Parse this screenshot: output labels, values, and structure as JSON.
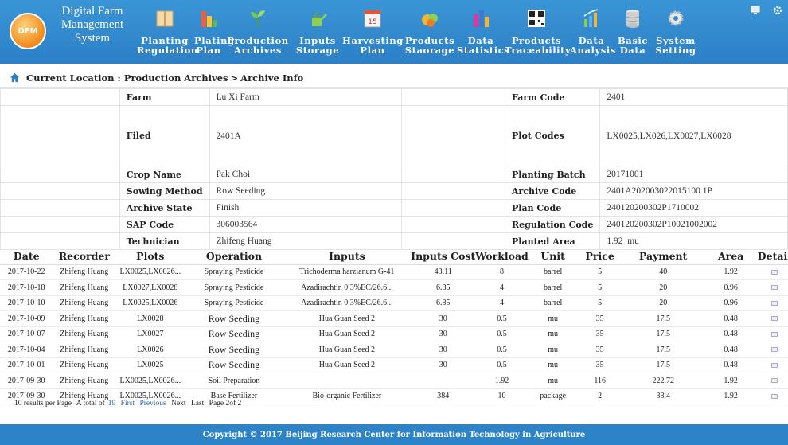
{
  "header": {
    "logo_text": "DFM",
    "system_name": [
      "Digital Farm",
      "Management",
      "System"
    ],
    "menu": [
      {
        "label": "Planting\nRegulation",
        "icon": "book-icon",
        "color": "#f6d9a6"
      },
      {
        "label": "Plating\nPlan",
        "icon": "bar-chart-icon",
        "color": "#f25d3c"
      },
      {
        "label": "Production\nArchives",
        "icon": "sprout-icon",
        "color": "#7cc84a"
      },
      {
        "label": "Inputs\nStorage",
        "icon": "watering-can-icon",
        "color": "#8fcf52"
      },
      {
        "label": "Harvesting\nPlan",
        "icon": "calendar-icon",
        "color": "#f5f5f5"
      },
      {
        "label": "Products\nStaorage",
        "icon": "produce-icon",
        "color": "#f3b535"
      },
      {
        "label": "Data\nStatistics",
        "icon": "columns-icon",
        "color": "#d93aa0"
      },
      {
        "label": "Products\nTraceability",
        "icon": "qr-code-icon",
        "color": "#222222"
      },
      {
        "label": "Data\nAnalysis",
        "icon": "analysis-icon",
        "color": "#8bd04a"
      },
      {
        "label": "Basic\nData",
        "icon": "database-icon",
        "color": "#e5e5e5"
      },
      {
        "label": "System\nSetting",
        "icon": "gear-icon",
        "color": "#e8e8e8"
      }
    ]
  },
  "breadcrumb": {
    "prefix": "Current Location :",
    "section": "Production Archives",
    "separator": ">",
    "page": "Archive Info"
  },
  "info": {
    "farm_label": "Farm",
    "farm": "Lu Xi Farm",
    "farm_code_label": "Farm Code",
    "farm_code": "2401",
    "filed_label": "Filed",
    "filed": "2401A",
    "plot_codes_label": "Plot Codes",
    "plot_codes": "LX0025,LX026,LX0027,LX0028",
    "crop_label": "Crop Name",
    "crop": "Pak Choi",
    "batch_label": "Planting Batch",
    "batch": "20171001",
    "sowing_label": "Sowing Method",
    "sowing": "Row Seeding",
    "archive_code_label": "Archive Code",
    "archive_code": "2401A202003022015100 1P",
    "state_label": "Archive State",
    "state": "Finish",
    "plan_code_label": "Plan Code",
    "plan_code": "240120200302P1710002",
    "sap_label": "SAP Code",
    "sap": "306003564",
    "reg_code_label": "Regulation Code",
    "reg_code": "240120200302P10021002002",
    "tech_label": "Technician",
    "tech": "Zhifeng Huang",
    "area_label": "Planted Area",
    "area": "1.92",
    "area_unit": "mu"
  },
  "grid": {
    "columns": [
      "Date",
      "Recorder",
      "Plots",
      "Operation",
      "Inputs",
      "Inputs Cost",
      "Workload",
      "Unit",
      "Price",
      "Payment",
      "Area",
      "Detail"
    ],
    "rows": [
      [
        "2017-10-22",
        "Zhifeng Huang",
        "LX0025,LX0026...",
        "Spraying Pesticide",
        "Trichoderma harzianum G-41",
        "43.11",
        "8",
        "barrel",
        "5",
        "40",
        "1.92"
      ],
      [
        "2017-10-18",
        "Zhifeng Huang",
        "LX0027,LX0028",
        "Spraying Pesticide",
        "Azadirachtin 0.3%EC/26.6...",
        "6.85",
        "4",
        "barrel",
        "5",
        "20",
        "0.96"
      ],
      [
        "2017-10-10",
        "Zhifeng Huang",
        "LX0025,LX0026",
        "Spraying Pesticide",
        "Azadirachtin 0.3%EC/26.6...",
        "6.85",
        "4",
        "barrel",
        "5",
        "20",
        "0.96"
      ],
      [
        "2017-10-09",
        "Zhifeng Huang",
        "LX0028",
        "Row Seeding",
        "Hua Guan Seed 2",
        "30",
        "0.5",
        "mu",
        "35",
        "17.5",
        "0.48"
      ],
      [
        "2017-10-07",
        "Zhifeng Huang",
        "LX0027",
        "Row Seeding",
        "Hua Guan Seed 2",
        "30",
        "0.5",
        "mu",
        "35",
        "17.5",
        "0.48"
      ],
      [
        "2017-10-04",
        "Zhifeng Huang",
        "LX0026",
        "Row Seeding",
        "Hua Guan Seed 2",
        "30",
        "0.5",
        "mu",
        "35",
        "17.5",
        "0.48"
      ],
      [
        "2017-10-01",
        "Zhifeng Huang",
        "LX0025",
        "Row Seeding",
        "Hua Guan Seed 2",
        "30",
        "0.5",
        "mu",
        "35",
        "17.5",
        "0.48"
      ],
      [
        "2017-09-30",
        "Zhifeng Huang",
        "LX0025,LX0026...",
        "Soil Preparation",
        "",
        "",
        "1.92",
        "mu",
        "116",
        "222.72",
        "1.92"
      ],
      [
        "2017-09-30",
        "Zhifeng Huang",
        "LX0025,LX0026...",
        "Base Fertilizer",
        "Bio-organic Fertilizer",
        "384",
        "10",
        "package",
        "2",
        "38.4",
        "1.92"
      ]
    ]
  },
  "pager": {
    "per_page": "10 results per Page",
    "total_prefix": "A total of",
    "total": "19",
    "first": "First",
    "previous": "Previous",
    "next": "Next",
    "last": "Last",
    "page_info": "Page 2of 2"
  },
  "footer": {
    "copyright": "Copyright © 2017 Beijing Research Center for Information Technology in Agriculture"
  }
}
